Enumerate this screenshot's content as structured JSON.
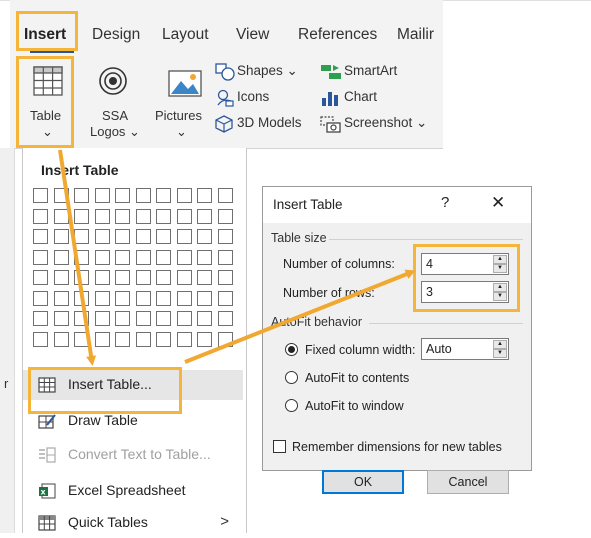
{
  "ribbon": {
    "tabs": [
      {
        "label": "Insert",
        "active": true
      },
      {
        "label": "Design"
      },
      {
        "label": "Layout"
      },
      {
        "label": "View"
      },
      {
        "label": "References"
      },
      {
        "label": "Mailir"
      }
    ],
    "table_label": "Table",
    "table_arrow": "⌄",
    "ssa_line1": "SSA",
    "ssa_line2": "Logos ⌄",
    "pictures_label": "Pictures",
    "pictures_arrow": "⌄",
    "shapes_label": "Shapes ⌄",
    "icons_label": "Icons",
    "models_label": "3D Models",
    "smartart_label": "SmartArt",
    "chart_label": "Chart",
    "screenshot_label": "Screenshot ⌄"
  },
  "dropdown": {
    "title": "Insert Table",
    "grid": {
      "columns": 10,
      "rows": 8
    },
    "items": [
      {
        "label": "Insert Table...",
        "icon": "table-grid-icon"
      },
      {
        "label": "Draw Table",
        "icon": "pencil-table-icon"
      },
      {
        "label": "Convert Text to Table...",
        "icon": "convert-text-icon",
        "disabled": true
      },
      {
        "label": "Excel Spreadsheet",
        "icon": "excel-icon"
      },
      {
        "label": "Quick Tables",
        "icon": "quick-tables-icon",
        "submenu_arrow": ">"
      }
    ]
  },
  "dialog": {
    "title": "Insert Table",
    "help": "?",
    "close": "✕",
    "table_size_label": "Table size",
    "columns_label": "Number of columns:",
    "columns_value": "4",
    "rows_label": "Number of rows:",
    "rows_value": "3",
    "autofit_label": "AutoFit behavior",
    "fixed_label": "Fixed column width:",
    "fixed_value": "Auto",
    "autofit_contents_label": "AutoFit to contents",
    "autofit_window_label": "AutoFit to window",
    "remember_label": "Remember dimensions for new tables",
    "ok_label": "OK",
    "cancel_label": "Cancel",
    "spin_up": "▲",
    "spin_down": "▼"
  },
  "side_fragment": "r",
  "colors": {
    "highlight": "#f5b43a",
    "arrow": "#f0a830",
    "accent": "#2b579a",
    "default_button_border": "#0078d7"
  }
}
